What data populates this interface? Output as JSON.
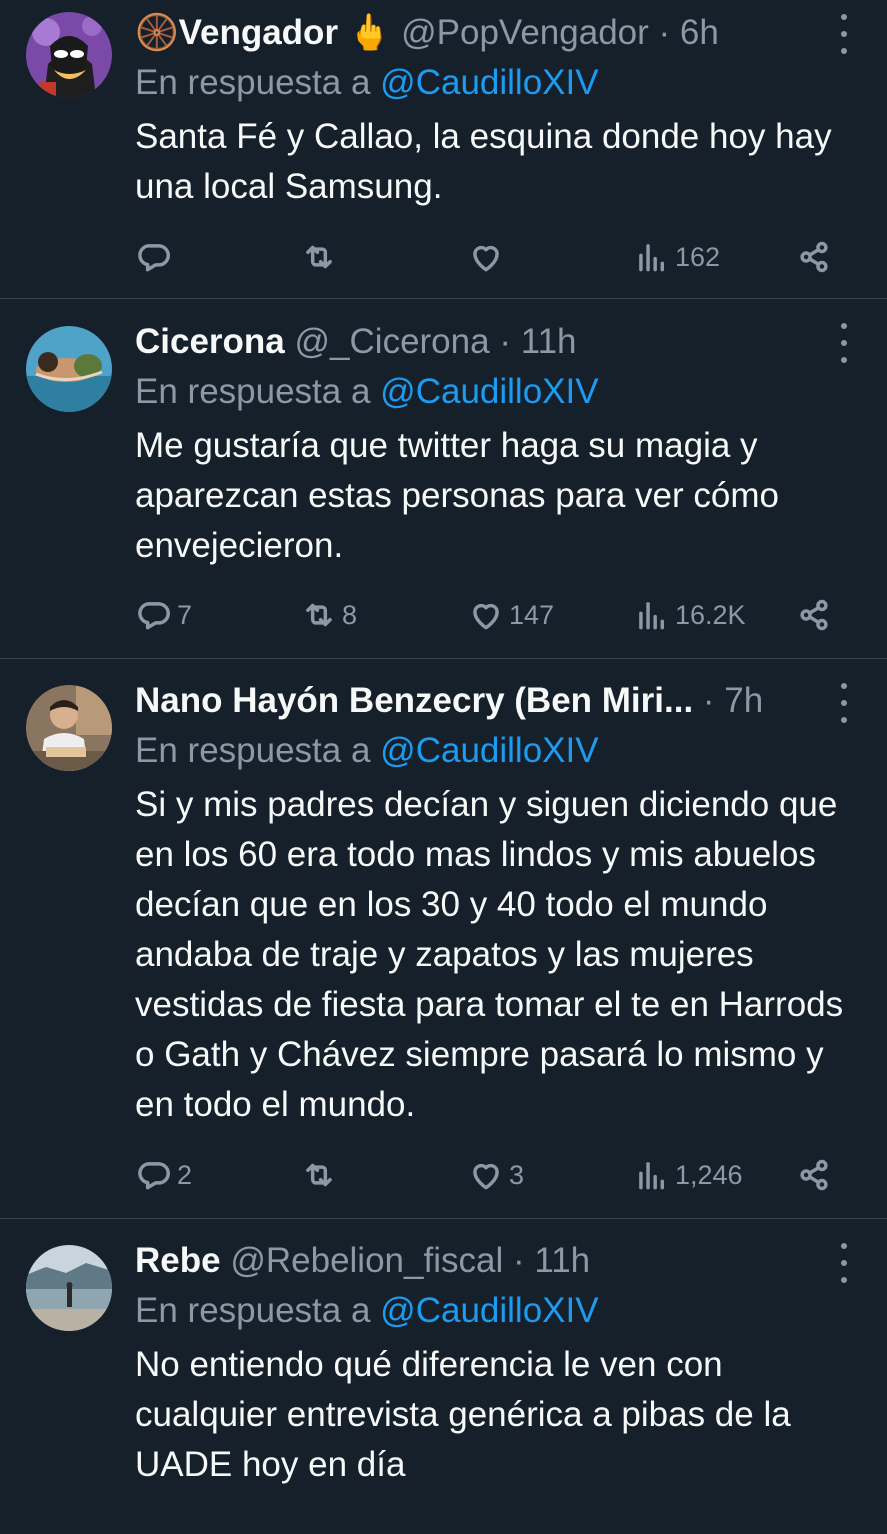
{
  "tweets": [
    {
      "display_name": "🛞Vengador 🖕",
      "handle": "@PopVengador",
      "time": "· 6h",
      "reply_prefix": "En respuesta a",
      "reply_to": "@CaudilloXIV",
      "text": "Santa Fé y Callao, la esquina donde hoy hay una local Samsung.",
      "replies": "",
      "retweets": "",
      "likes": "",
      "views": "162"
    },
    {
      "display_name": "Cicerona",
      "handle": "@_Cicerona",
      "time": "· 11h",
      "reply_prefix": "En respuesta a",
      "reply_to": "@CaudilloXIV",
      "text": "Me gustaría que twitter haga su magia y aparezcan estas personas para ver cómo envejecieron.",
      "replies": "7",
      "retweets": "8",
      "likes": "147",
      "views": "16.2K"
    },
    {
      "display_name": "Nano Hayón Benzecry (Ben Miri...",
      "handle": "",
      "time": "· 7h",
      "reply_prefix": "En respuesta a",
      "reply_to": "@CaudilloXIV",
      "text": "Si y mis padres decían y siguen diciendo que en los 60 era todo mas lindos y mis abuelos decían que en los 30 y 40 todo el mundo andaba de traje y zapatos y las mujeres vestidas de fiesta para tomar el te en Harrods o Gath y Chávez siempre pasará lo mismo y en todo el mundo.",
      "replies": "2",
      "retweets": "",
      "likes": "3",
      "views": "1,246"
    },
    {
      "display_name": "Rebe",
      "handle": "@Rebelion_fiscal",
      "time": "· 11h",
      "reply_prefix": "En respuesta a",
      "reply_to": "@CaudilloXIV",
      "text": "No entiendo qué diferencia le ven con cualquier entrevista genérica a pibas de la UADE hoy en día",
      "replies": "",
      "retweets": "",
      "likes": "",
      "views": ""
    }
  ],
  "icons": {
    "reply": "reply-icon",
    "retweet": "retweet-icon",
    "like": "heart-icon",
    "views": "views-icon",
    "share": "share-icon",
    "more": "more-icon"
  },
  "colors": {
    "background": "#15202b",
    "text": "#f7f9f9",
    "muted": "#8b98a5",
    "accent": "#1d9bf0",
    "divider": "#38444d"
  }
}
